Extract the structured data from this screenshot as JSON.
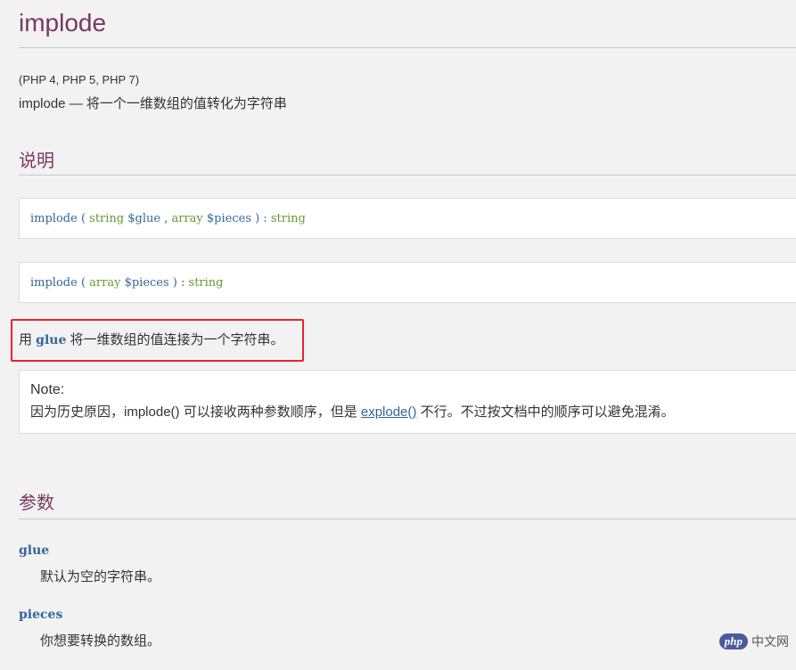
{
  "header": {
    "title": "implode",
    "versions": "(PHP 4, PHP 5, PHP 7)",
    "purpose_name": "implode",
    "purpose_sep": " — ",
    "purpose_text": "将一个一维数组的值转化为字符串"
  },
  "description": {
    "heading": "说明",
    "signature1": {
      "fn": "implode",
      "open": " ( ",
      "type1": "string",
      "var1": " $glue",
      "comma": " , ",
      "type2": "array",
      "var2": " $pieces",
      "close": " ) : ",
      "ret": "string"
    },
    "signature2": {
      "fn": "implode",
      "open": " ( ",
      "type1": "array",
      "var1": " $pieces",
      "close": " ) : ",
      "ret": "string"
    },
    "line_pre": "用 ",
    "line_code": "glue",
    "line_post": " 将一维数组的值连接为一个字符串。"
  },
  "note": {
    "heading": "Note",
    "colon": ":",
    "text_pre": "因为历史原因，implode() 可以接收两种参数顺序，但是 ",
    "link": "explode()",
    "text_post": " 不行。不过按文档中的顺序可以避免混淆。"
  },
  "parameters": {
    "heading": "参数",
    "items": [
      {
        "name": "glue",
        "desc": "默认为空的字符串。"
      },
      {
        "name": "pieces",
        "desc": "你想要转换的数组。"
      }
    ]
  },
  "watermark": {
    "logo": "php",
    "text": "中文网"
  },
  "colors": {
    "heading": "#793862",
    "code": "#336699",
    "type": "#669933",
    "highlight": "#e8232e"
  }
}
